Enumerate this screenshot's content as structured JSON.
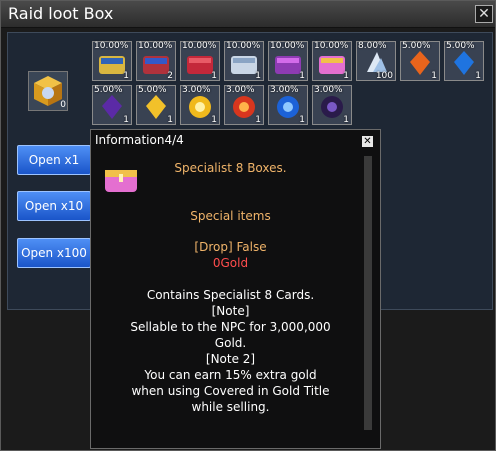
{
  "window": {
    "title": "Raid loot Box"
  },
  "slots": [
    {
      "pct": "10.00%",
      "count": "1",
      "icon": "chest-gold-blue"
    },
    {
      "pct": "10.00%",
      "count": "2",
      "icon": "chest-red-blue"
    },
    {
      "pct": "10.00%",
      "count": "1",
      "icon": "chest-red"
    },
    {
      "pct": "10.00%",
      "count": "1",
      "icon": "chest-silver"
    },
    {
      "pct": "10.00%",
      "count": "1",
      "icon": "chest-purple"
    },
    {
      "pct": "10.00%",
      "count": "1",
      "icon": "chest-pink"
    },
    {
      "pct": "8.00%",
      "count": "100",
      "icon": "crystal-white"
    },
    {
      "pct": "5.00%",
      "count": "1",
      "icon": "shard-orange"
    },
    {
      "pct": "5.00%",
      "count": "1",
      "icon": "shard-blue"
    },
    {
      "pct": "5.00%",
      "count": "1",
      "icon": "shard-purple"
    },
    {
      "pct": "5.00%",
      "count": "1",
      "icon": "shard-gold"
    },
    {
      "pct": "3.00%",
      "count": "1",
      "icon": "orb-gold"
    },
    {
      "pct": "3.00%",
      "count": "1",
      "icon": "orb-fire"
    },
    {
      "pct": "3.00%",
      "count": "1",
      "icon": "orb-water"
    },
    {
      "pct": "3.00%",
      "count": "1",
      "icon": "orb-dark"
    }
  ],
  "box": {
    "count": "0"
  },
  "buttons": {
    "open1": "Open x1",
    "open10": "Open x10",
    "open100": "Open x100"
  },
  "info": {
    "title": "Information4/4",
    "name": "Specialist 8 Boxes.",
    "type": "Special items",
    "drop": "[Drop] False",
    "gold": "0Gold",
    "desc1": "Contains Specialist 8 Cards.",
    "note": "[Note]",
    "desc2": "Sellable to the NPC for 3,000,000",
    "desc3": "Gold.",
    "note2": "[Note 2]",
    "desc4": "You can earn 15% extra gold",
    "desc5": "when using Covered in Gold Title",
    "desc6": "while selling."
  }
}
